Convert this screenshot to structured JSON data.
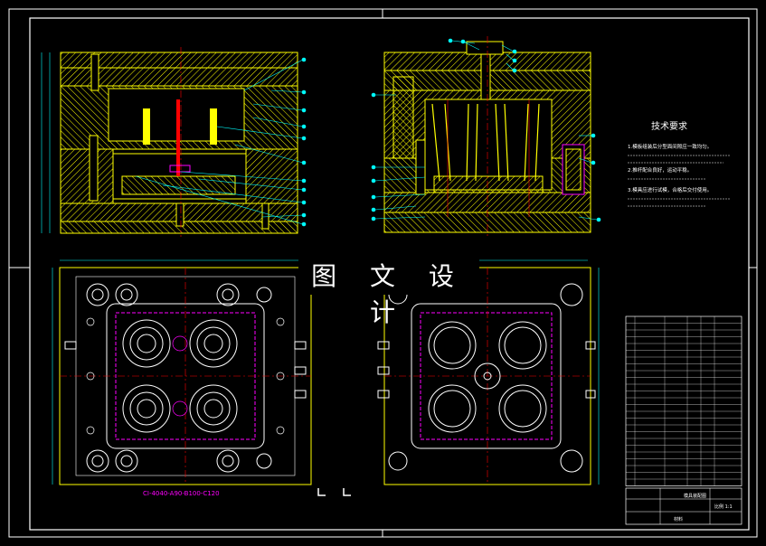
{
  "title_text": "图 文 设 计",
  "tech_requirements": {
    "heading": "技术要求",
    "lines": [
      "1.模板组装后分型面间隙应一致均匀。",
      "2.推杆配合良好，运动平稳。",
      "3.模具应进行试模，合格后交付使用。"
    ]
  },
  "mold_base_label": "CI-4040-A90-B100-C120",
  "title_block": {
    "drawing_name": "模具装配图",
    "scale_label": "比例 1:1",
    "material_label": "材料"
  },
  "colors": {
    "background": "#000000",
    "yellow": "#ffff00",
    "cyan": "#00ffff",
    "white": "#ffffff",
    "red": "#ff0000",
    "magenta": "#ff00ff",
    "blue": "#0000ff",
    "green": "#00ff00"
  }
}
